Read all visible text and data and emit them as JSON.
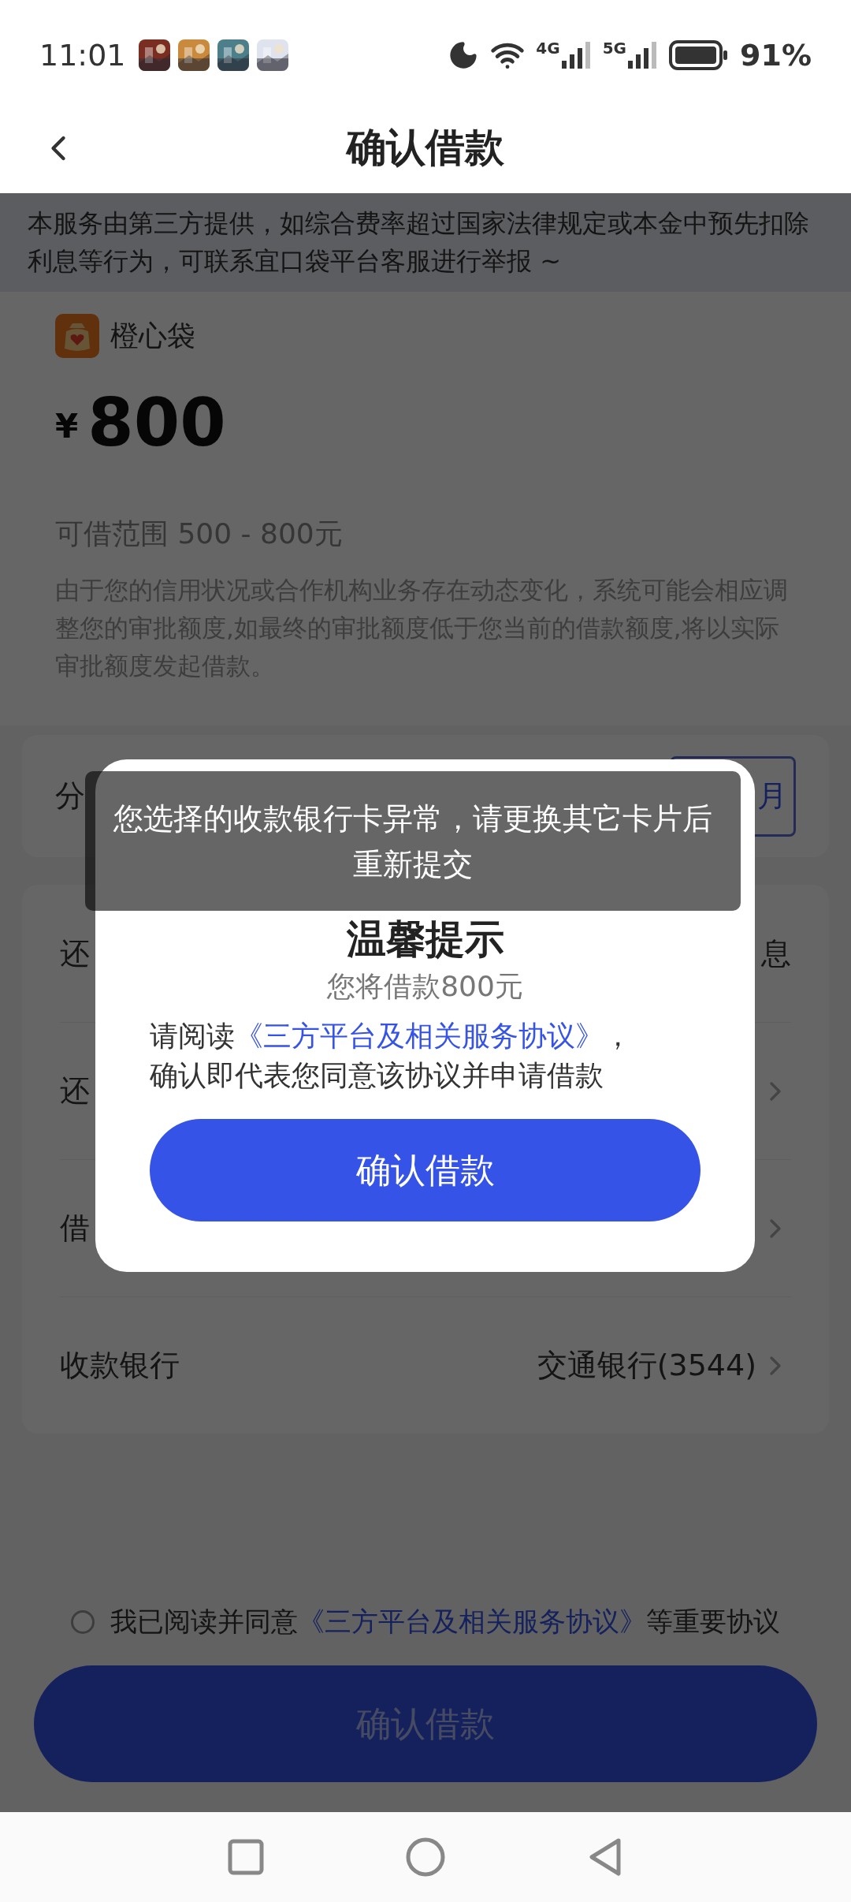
{
  "status_bar": {
    "time": "11:01",
    "network_labels": [
      "4G",
      "5G"
    ],
    "battery": "91%"
  },
  "header": {
    "title": "确认借款"
  },
  "notice": "本服务由第三方提供，如综合费率超过国家法律规定或本金中预先扣除利息等行为，可联系宜口袋平台客服进行举报 ~",
  "loan_card": {
    "lender": "橙心袋",
    "currency": "¥",
    "amount": "800",
    "range": "可借范围 500 - 800元",
    "note": "由于您的信用状况或合作机构业务存在动态变化，系统可能会相应调整您的审批额度,如最终的审批额度低于您当前的借款额度,将以实际审批额度发起借款。"
  },
  "term_row": {
    "label": "分",
    "value": "月"
  },
  "detail_rows": [
    {
      "label": "还",
      "value": "息",
      "chevron": false
    },
    {
      "label": "还",
      "chevron": true
    },
    {
      "label": "借",
      "chevron": true
    },
    {
      "label": "收款银行",
      "value": "交通银行(3544)",
      "chevron": true
    }
  ],
  "agreement": {
    "checked": false,
    "before": "我已阅读并同意",
    "link": "《三方平台及相关服务协议》",
    "after": "等重要协议"
  },
  "submit_button": "确认借款",
  "dialog": {
    "title": "温馨提示",
    "subtitle": "您将借款800元",
    "before": "请阅读",
    "link": "《三方平台及相关服务协议》",
    "after": "，",
    "line2": "确认即代表您同意该协议并申请借款",
    "button": "确认借款"
  },
  "toast": "您选择的收款银行卡异常，请更换其它卡片后重新提交"
}
